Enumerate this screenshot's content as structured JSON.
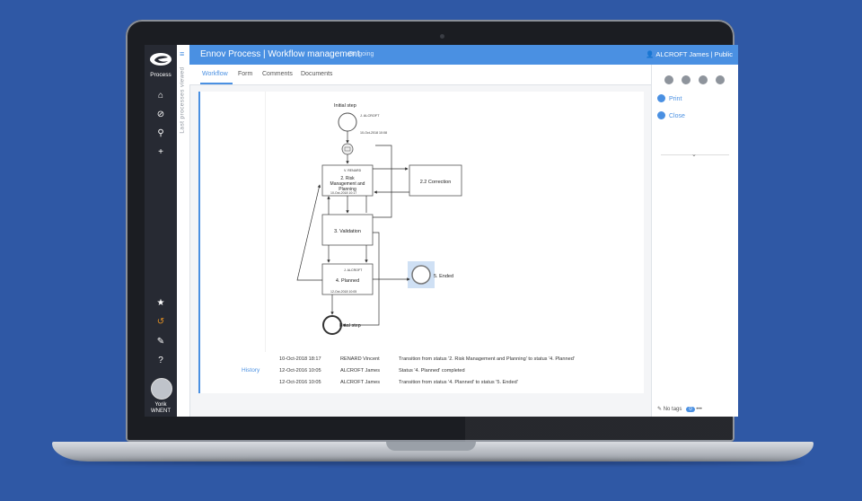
{
  "app": {
    "logo_label": "Process",
    "title": "Ennov Process | Workflow management",
    "status": "On going",
    "user": "ALCROFT James | Public",
    "side_strip_label": "Last processes viewed",
    "current_user": "Yorik WNENT"
  },
  "icons": {
    "nav": [
      "home-icon",
      "ban-icon",
      "search-icon",
      "plus-icon",
      "star-icon",
      "history-icon",
      "tag-icon",
      "help-icon"
    ]
  },
  "tabs": [
    {
      "label": "Workflow"
    },
    {
      "label": "Form"
    },
    {
      "label": "Comments"
    },
    {
      "label": "Documents"
    }
  ],
  "workflow": {
    "initial_step": "Initial step",
    "initial_user": "J. ALCROFT",
    "initial_date": "10-Oct-2018 10:08",
    "step2_user": "V. RENARD",
    "step2_label_line1": "2. Risk",
    "step2_label_line2": "Management and",
    "step2_label_line3": "Planning",
    "step2_date": "10-Oct-2018 10:17",
    "correction": "2.2 Correction",
    "validation": "3. Validation",
    "planned_user": "J. ALCROFT",
    "planned": "4. Planned",
    "planned_date": "12-Oct-2018 10:05",
    "ended": "5. Ended",
    "final_step": "Final step"
  },
  "history": {
    "label": "History",
    "rows": [
      {
        "date": "10-Oct-2018 18:17",
        "user": "RENARD Vincent",
        "text": "Transition from status '2. Risk Management and Planning' to status '4. Planned'"
      },
      {
        "date": "12-Oct-2016 10:05",
        "user": "ALCROFT James",
        "text": "Status '4. Planned' completed"
      },
      {
        "date": "12-Oct-2016 10:05",
        "user": "ALCROFT James",
        "text": "Transition from status '4. Planned' to status '5. Ended'"
      }
    ]
  },
  "right_pane": {
    "print": "Print",
    "close": "Close",
    "tags": "No tags",
    "badge": "0",
    "more": "•••"
  },
  "colors": {
    "accent": "#4a90e2",
    "nav_bg": "#272a33",
    "active_nav": "#e89323",
    "background": "#2f58a5"
  }
}
